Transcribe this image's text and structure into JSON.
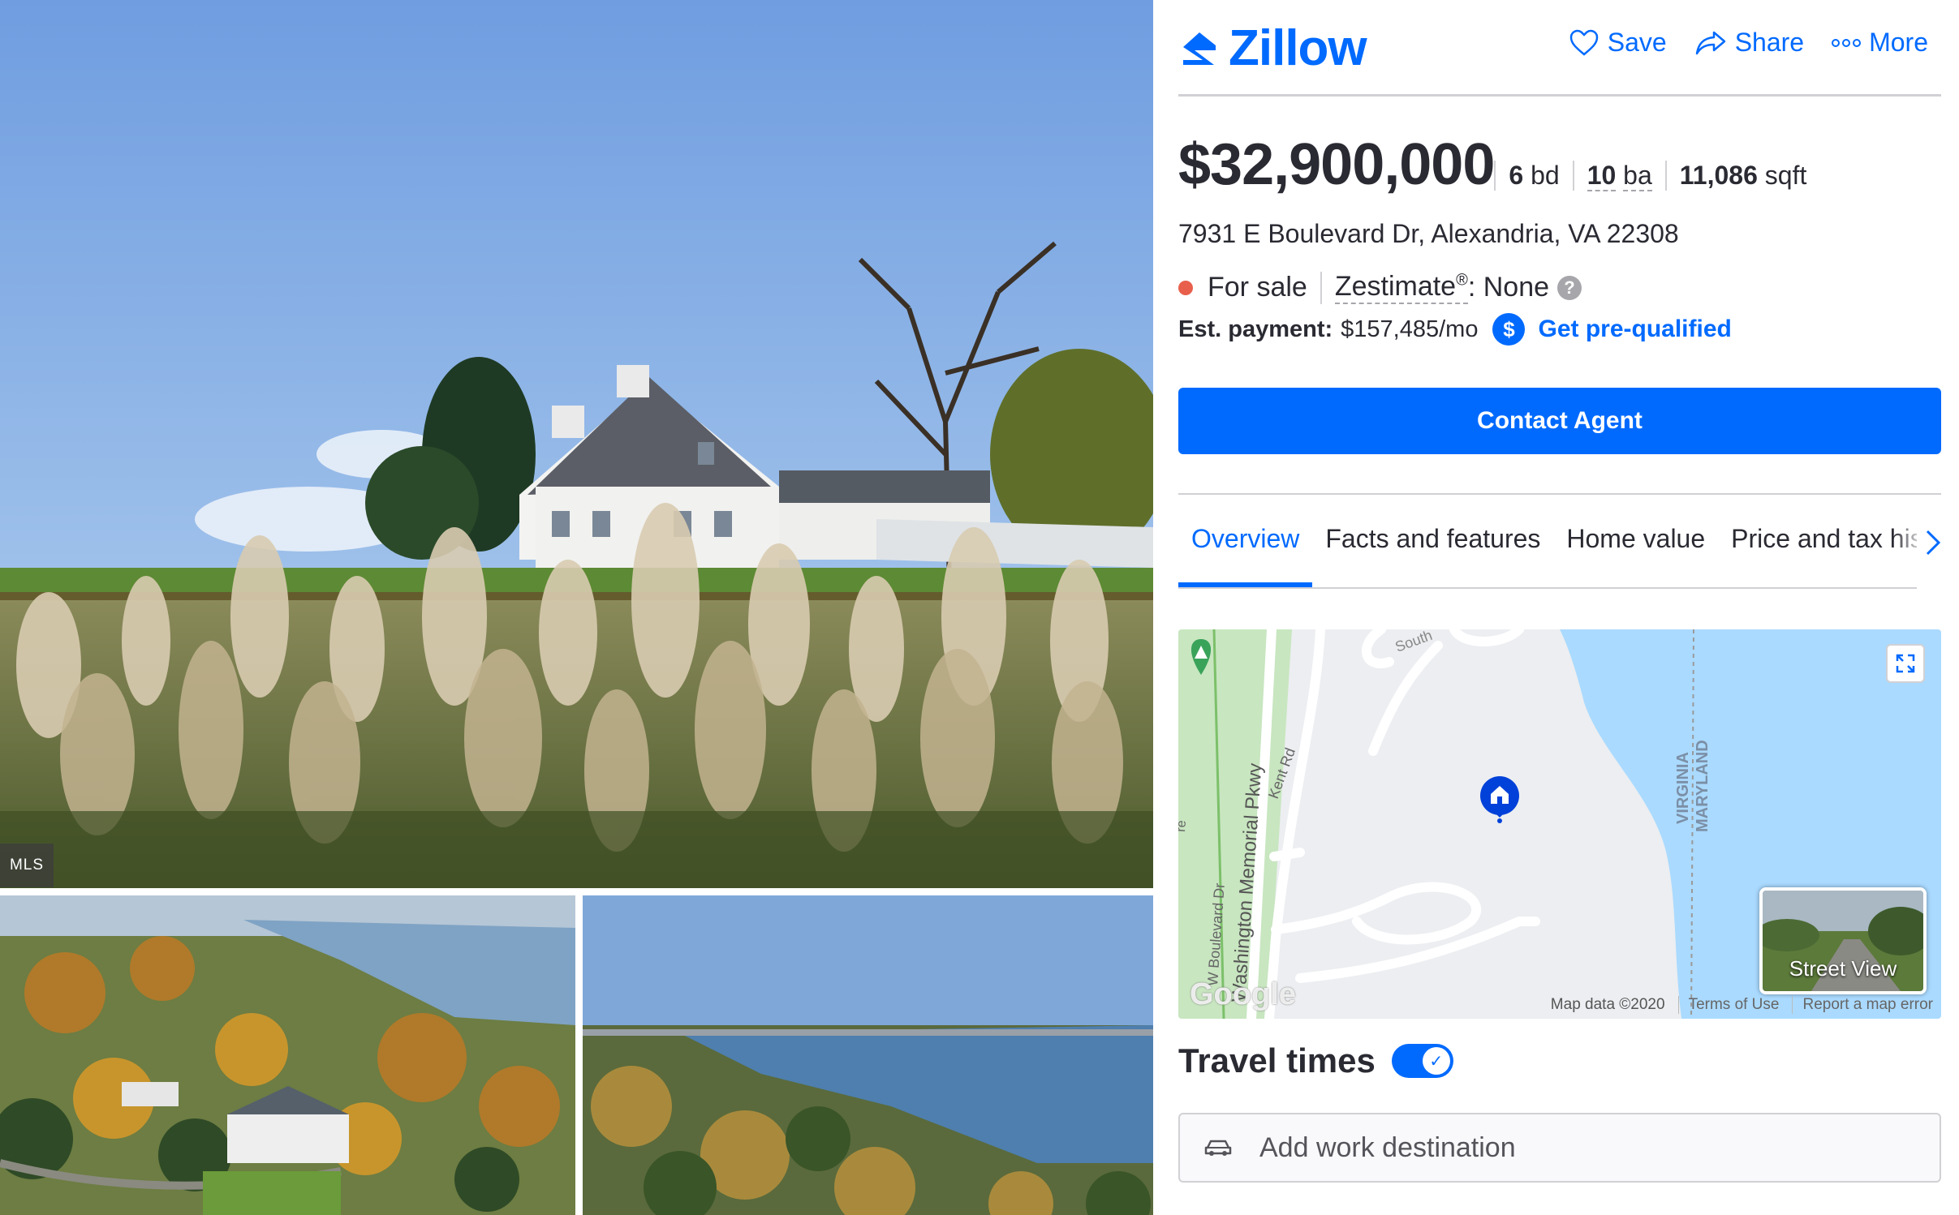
{
  "gallery": {
    "mls_badge": "MLS"
  },
  "header": {
    "brand": "Zillow",
    "actions": {
      "save": "Save",
      "share": "Share",
      "more": "More"
    }
  },
  "listing": {
    "price": "$32,900,000",
    "beds_value": "6",
    "beds_unit": "bd",
    "baths_value": "10",
    "baths_unit": "ba",
    "sqft_value": "11,086",
    "sqft_unit": "sqft",
    "address": "7931 E Boulevard Dr, Alexandria, VA 22308",
    "status": "For sale",
    "zestimate_label": "Zestimate",
    "zestimate_mark": "®",
    "zestimate_value": ": None",
    "help_glyph": "?",
    "payment_label": "Est. payment:",
    "payment_value": "$157,485/mo",
    "prequal": "Get pre-qualified",
    "contact": "Contact Agent"
  },
  "tabs": [
    {
      "label": "Overview",
      "active": true
    },
    {
      "label": "Facts and features",
      "active": false
    },
    {
      "label": "Home value",
      "active": false
    },
    {
      "label": "Price and tax hist",
      "active": false
    }
  ],
  "map": {
    "labels": {
      "south": "South",
      "kent_rd": "Kent Rd",
      "parkway": "Washington Memorial Pkwy",
      "w_boulevard": "W Boulevard Dr",
      "virginia": "VIRGINIA",
      "maryland": "MARYLAND",
      "edge": "re"
    },
    "street_view": "Street View",
    "google": "Google",
    "map_data": "Map data ©2020",
    "terms": "Terms of Use",
    "report": "Report a map error"
  },
  "travel": {
    "title": "Travel times",
    "toggle_on": true,
    "placeholder": "Add work destination"
  },
  "colors": {
    "brand_blue": "#006aff",
    "status_red": "#e8604c",
    "text": "#2a2a33",
    "water": "#aadaff",
    "park": "#c8e6c0"
  }
}
